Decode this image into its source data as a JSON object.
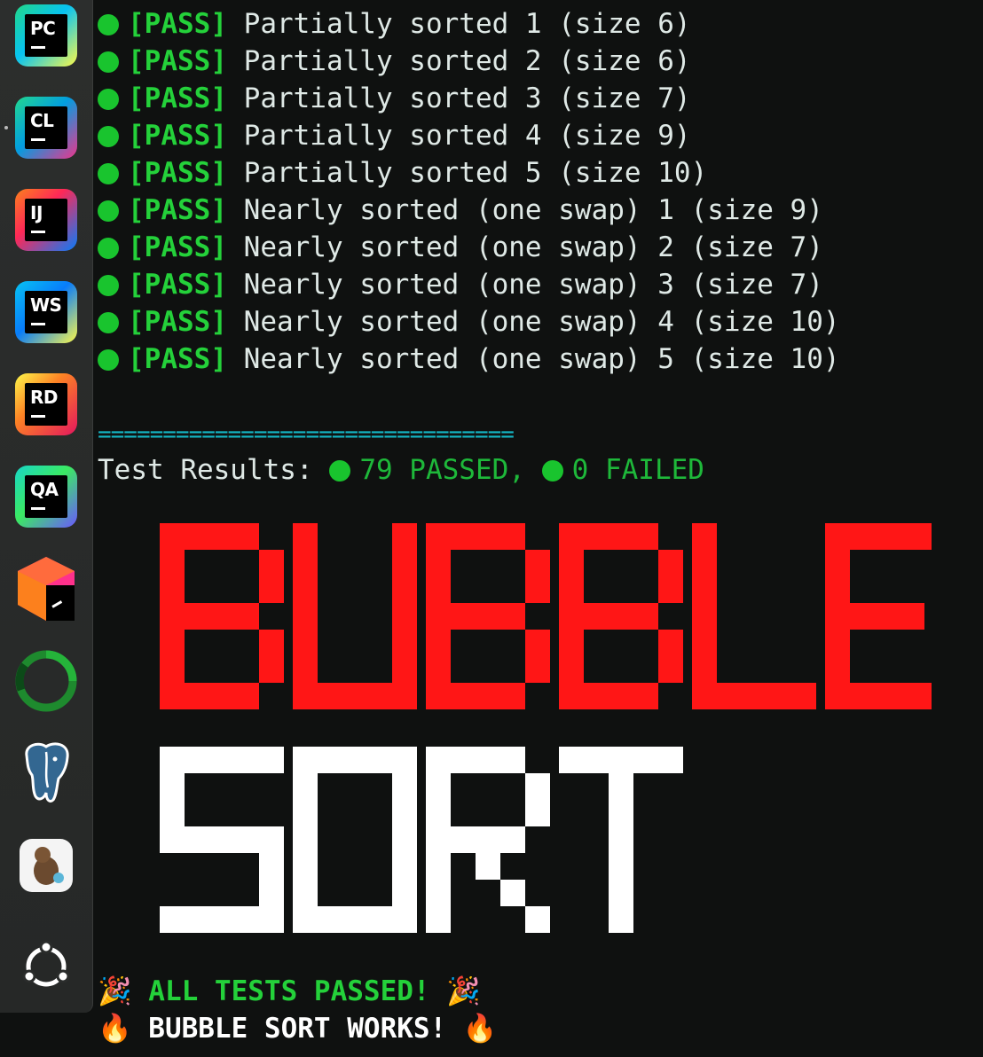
{
  "dock": {
    "apps": [
      {
        "id": "pycharm",
        "abbr": "PC"
      },
      {
        "id": "clion",
        "abbr": "CL"
      },
      {
        "id": "intellij",
        "abbr": "IJ"
      },
      {
        "id": "webstorm",
        "abbr": "WS"
      },
      {
        "id": "rider",
        "abbr": "RD"
      },
      {
        "id": "aqua",
        "abbr": "QA"
      },
      {
        "id": "jetbrains-toolbox",
        "abbr": ""
      },
      {
        "id": "ring-app",
        "abbr": ""
      },
      {
        "id": "postgresql",
        "abbr": ""
      },
      {
        "id": "fork-git",
        "abbr": ""
      },
      {
        "id": "ubuntu",
        "abbr": ""
      }
    ]
  },
  "terminal": {
    "results": [
      {
        "status": "[PASS]",
        "text": "Partially sorted 1 (size 6)"
      },
      {
        "status": "[PASS]",
        "text": "Partially sorted 2 (size 6)"
      },
      {
        "status": "[PASS]",
        "text": "Partially sorted 3 (size 7)"
      },
      {
        "status": "[PASS]",
        "text": "Partially sorted 4 (size 9)"
      },
      {
        "status": "[PASS]",
        "text": "Partially sorted 5 (size 10)"
      },
      {
        "status": "[PASS]",
        "text": "Nearly sorted (one swap) 1 (size 9)"
      },
      {
        "status": "[PASS]",
        "text": "Nearly sorted (one swap) 2 (size 7)"
      },
      {
        "status": "[PASS]",
        "text": "Nearly sorted (one swap) 3 (size 7)"
      },
      {
        "status": "[PASS]",
        "text": "Nearly sorted (one swap) 4 (size 10)"
      },
      {
        "status": "[PASS]",
        "text": "Nearly sorted (one swap) 5 (size 10)"
      }
    ],
    "separator": "================================",
    "summary_label": "Test Results:",
    "passed": "79 PASSED,",
    "failed": "0 FAILED",
    "big_word_1": "BUBBLE",
    "big_word_2": "SORT",
    "final_1": "ALL TESTS PASSED!",
    "final_2": "BUBBLE SORT WORKS!",
    "party_emoji": "🎉",
    "fire_emoji": "🔥"
  },
  "colors": {
    "pass_green": "#24d13a",
    "dot_green": "#19c42e",
    "separator_cyan": "#15b7c6",
    "banner_red": "#ff1616",
    "banner_white": "#ffffff"
  }
}
